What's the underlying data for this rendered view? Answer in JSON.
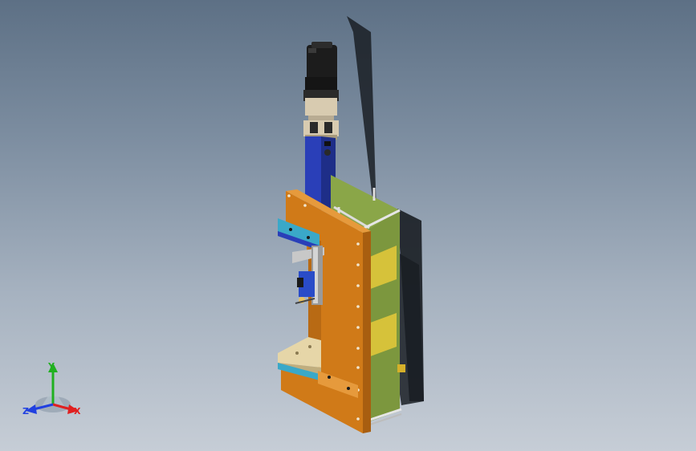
{
  "viewport": {
    "model": "press-assembly",
    "background_top": "#5d7085",
    "background_bottom": "#c6cdd6"
  },
  "colors": {
    "motor_black": "#1c1c1c",
    "coupling_beige": "#d8cbb0",
    "column_blue": "#2a3fb8",
    "frame_orange": "#d07a18",
    "side_plate_green": "#8aa648",
    "label_yellow": "#d6c23a",
    "block_cyan": "#3aa8c8",
    "table_beige": "#e6d6a8"
  },
  "triad": {
    "x_label": "X",
    "y_label": "Y",
    "z_label": "Z",
    "x_color": "#e02020",
    "y_color": "#20b020",
    "z_color": "#2040e0"
  }
}
